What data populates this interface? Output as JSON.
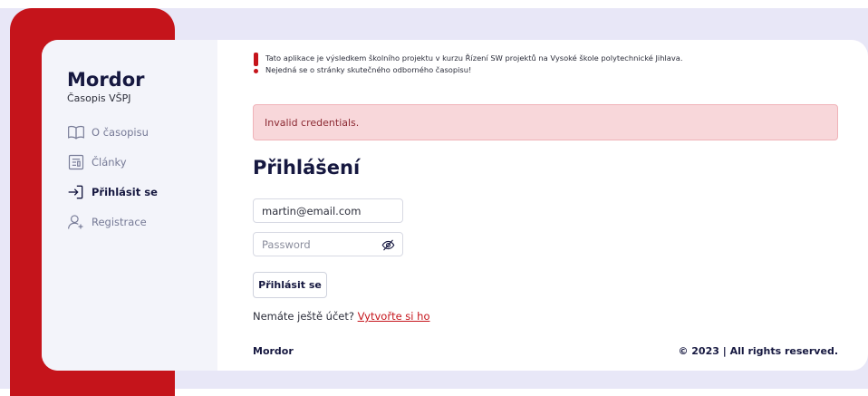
{
  "sidebar": {
    "brand": "Mordor",
    "subtitle": "Časopis VŠPJ",
    "items": [
      {
        "label": "O časopisu",
        "icon": "book-icon"
      },
      {
        "label": "Články",
        "icon": "newspaper-icon"
      },
      {
        "label": "Přihlásit se",
        "icon": "login-icon",
        "active": true
      },
      {
        "label": "Registrace",
        "icon": "user-add-icon"
      }
    ]
  },
  "notice": {
    "line1": "Tato aplikace je výsledkem školního projektu v kurzu Řízení SW projektů na Vysoké škole polytechnické Jihlava.",
    "line2": "Nejedná se o stránky skutečného odborného časopisu!"
  },
  "alert": {
    "text": "Invalid credentials."
  },
  "login": {
    "title": "Přihlášení",
    "email_value": "martin@email.com",
    "password_placeholder": "Password",
    "submit_label": "Přihlásit se",
    "signup_prompt": "Nemáte ještě účet?",
    "signup_link": "Vytvořte si ho"
  },
  "footer": {
    "brand": "Mordor",
    "copyright": "© 2023 | All rights reserved."
  },
  "colors": {
    "accent": "#c5141b",
    "navy": "#161840",
    "alert_bg": "#f8d7da"
  }
}
